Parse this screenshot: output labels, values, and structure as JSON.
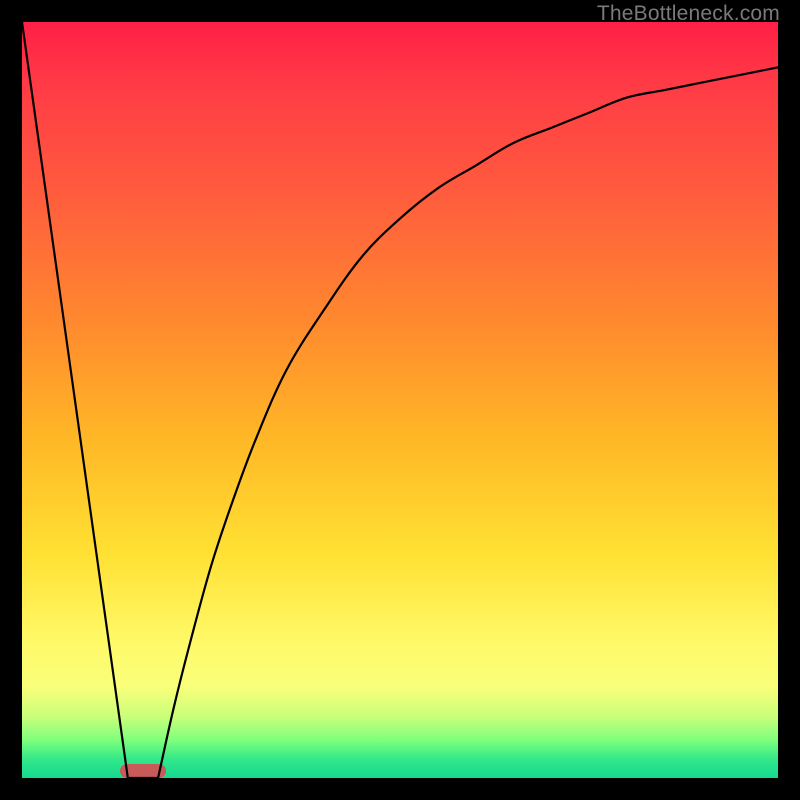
{
  "watermark": {
    "text": "TheBottleneck.com"
  },
  "colors": {
    "curve_stroke": "#000000",
    "marker_fill": "#c85a5a",
    "frame": "#000000"
  },
  "chart_data": {
    "type": "line",
    "title": "",
    "xlabel": "",
    "ylabel": "",
    "xlim": [
      0,
      100
    ],
    "ylim": [
      0,
      100
    ],
    "grid": false,
    "legend": false,
    "background_gradient": {
      "direction": "vertical",
      "stops": [
        {
          "pos": 0.0,
          "color": "#ff1f46"
        },
        {
          "pos": 0.4,
          "color": "#ff8a2e"
        },
        {
          "pos": 0.7,
          "color": "#ffe032"
        },
        {
          "pos": 0.88,
          "color": "#f9ff7a"
        },
        {
          "pos": 0.95,
          "color": "#7dff7c"
        },
        {
          "pos": 1.0,
          "color": "#15d98f"
        }
      ]
    },
    "series": [
      {
        "name": "left-line",
        "type": "line",
        "x": [
          0,
          14
        ],
        "y": [
          100,
          0
        ]
      },
      {
        "name": "right-curve",
        "type": "line",
        "x": [
          18,
          20,
          22,
          25,
          28,
          31,
          35,
          40,
          45,
          50,
          55,
          60,
          65,
          70,
          75,
          80,
          85,
          90,
          95,
          100
        ],
        "y": [
          0,
          9,
          17,
          28,
          37,
          45,
          54,
          62,
          69,
          74,
          78,
          81,
          84,
          86,
          88,
          90,
          91,
          92,
          93,
          94
        ]
      }
    ],
    "marker": {
      "name": "min-marker",
      "shape": "pill",
      "x_range": [
        13,
        19
      ],
      "y": 0,
      "color": "#c85a5a"
    }
  }
}
